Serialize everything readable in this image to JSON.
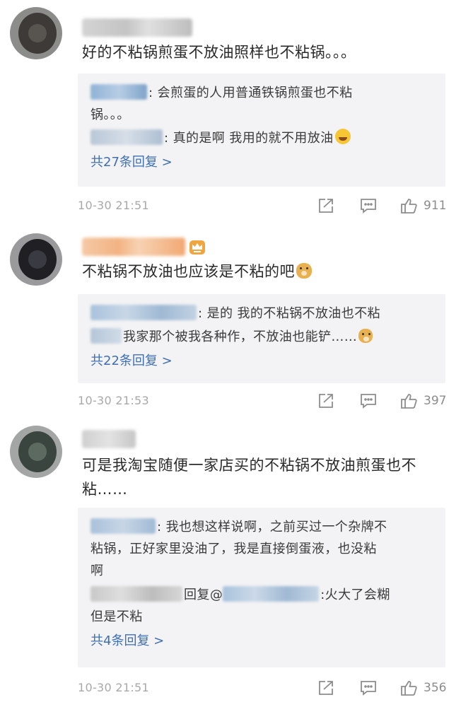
{
  "comments": [
    {
      "body": "好的不粘锅煎蛋不放油照样也不粘锅。。。",
      "replies": [
        {
          "text": ": 会煎蛋的人用普通铁锅煎蛋也不粘",
          "cont": "锅。。。"
        },
        {
          "text": ": 真的是啊 我用的就不用放油"
        }
      ],
      "more_replies": "共27条回复 >",
      "timestamp": "10-30 21:51",
      "likes": "911"
    },
    {
      "body": "不粘锅不放油也应该是不粘的吧",
      "replies": [
        {
          "text": ": 是的  我的不粘锅不放油也不粘"
        },
        {
          "text": "我家那个被我各种作，不放油也能铲……"
        }
      ],
      "more_replies": "共22条回复 >",
      "timestamp": "10-30 21:53",
      "likes": "397"
    },
    {
      "body_line1": "可是我淘宝随便一家店买的不粘锅不放油煎蛋也不",
      "body_line2": "粘……",
      "replies": [
        {
          "text": ": 我也想这样说啊，之前买过一个杂牌不",
          "cont": "粘锅，正好家里没油了，我是直接倒蛋液，也没粘",
          "cont2": "啊"
        },
        {
          "mid": "回复",
          "at": "@",
          "text": ":火大了会糊",
          "cont": "但是不粘"
        }
      ],
      "more_replies": "共4条回复 >",
      "timestamp": "10-30 21:51",
      "likes": "356"
    }
  ],
  "icons": {
    "share": "share-icon",
    "reply": "comment-icon",
    "like": "thumbs-up-icon",
    "vip_badge": "crown-icon",
    "emoji_laugh": "laugh-cry-emoji-icon",
    "emoji_doge": "doge-emoji-icon"
  },
  "colors": {
    "link": "#3e6fb3",
    "reply_bg": "#f3f3f5",
    "meta": "#a8a8a8"
  }
}
